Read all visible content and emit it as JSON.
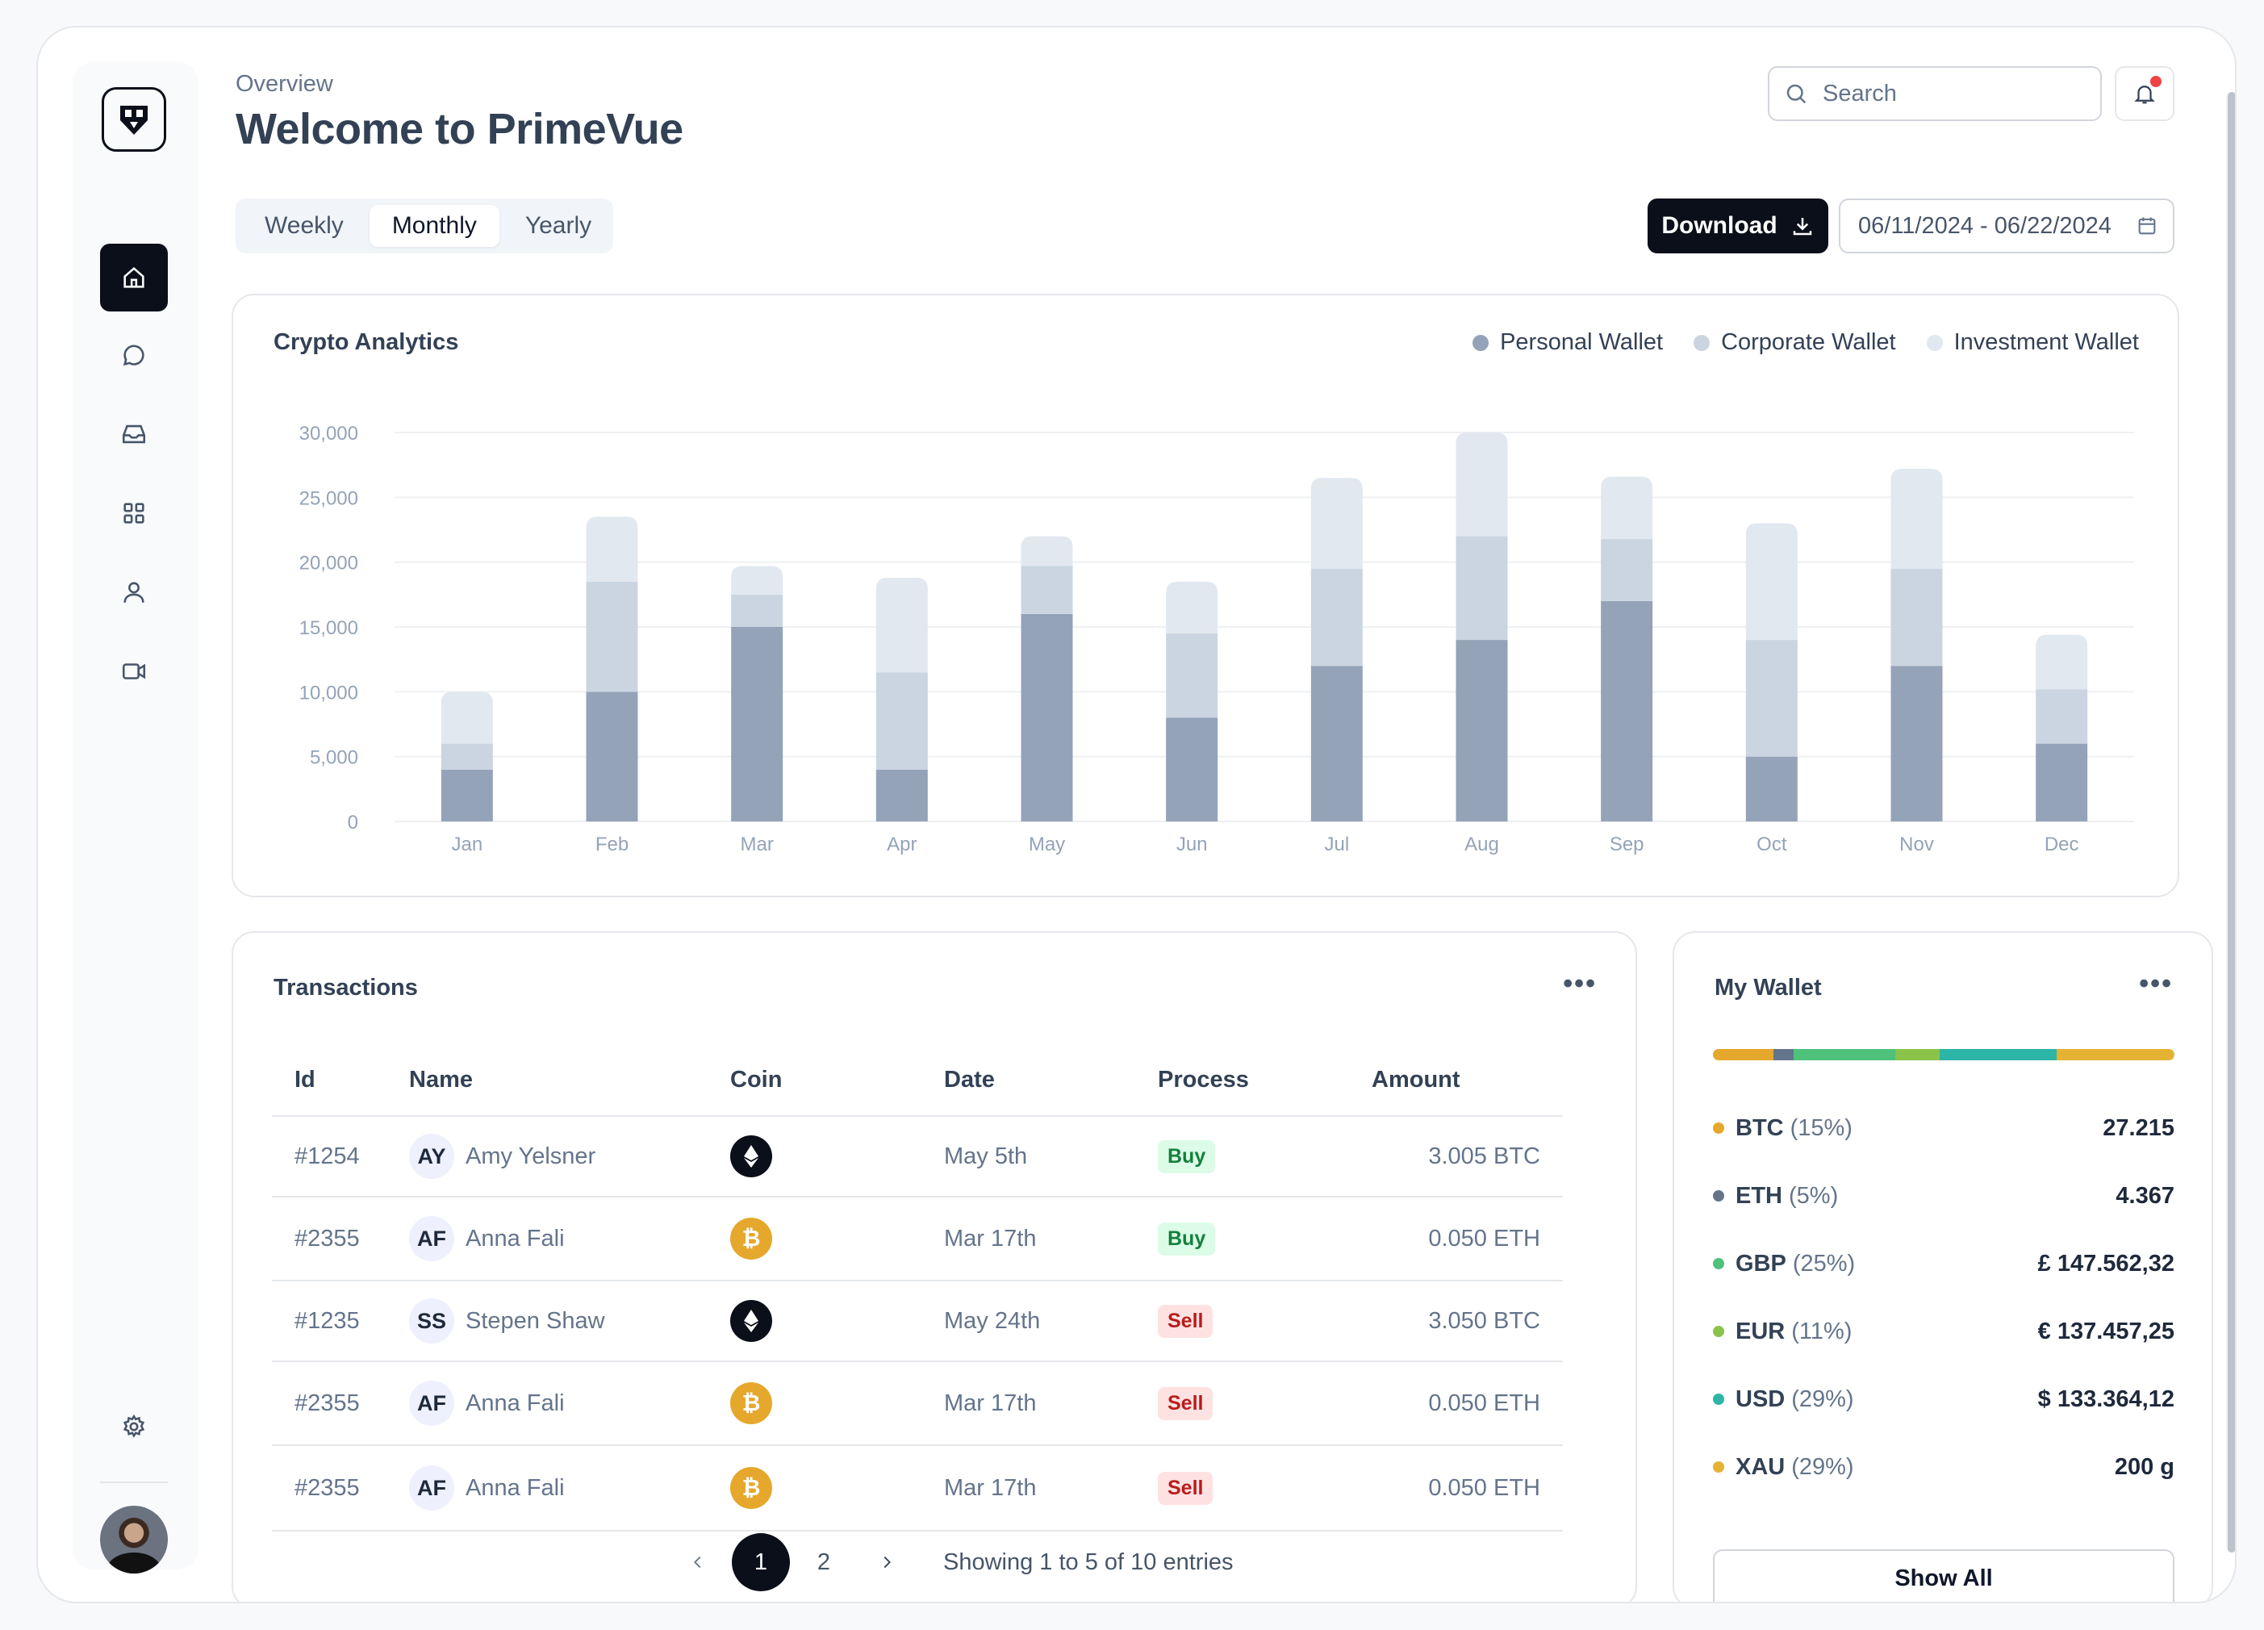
{
  "header": {
    "breadcrumb": "Overview",
    "title": "Welcome to PrimeVue",
    "search_placeholder": "Search"
  },
  "tabs": [
    {
      "label": "Weekly",
      "active": false
    },
    {
      "label": "Monthly",
      "active": true
    },
    {
      "label": "Yearly",
      "active": false
    }
  ],
  "toolbar": {
    "download_label": "Download",
    "date_range": "06/11/2024 - 06/22/2024"
  },
  "sidebar": {
    "items": [
      "home-icon",
      "chat-icon",
      "inbox-icon",
      "apps-icon",
      "user-icon",
      "video-icon"
    ],
    "active": "home-icon",
    "bottom": "gear-icon"
  },
  "chart_data": {
    "type": "bar",
    "title": "Crypto Analytics",
    "stacked": true,
    "categories": [
      "Jan",
      "Feb",
      "Mar",
      "Apr",
      "May",
      "Jun",
      "Jul",
      "Aug",
      "Sep",
      "Oct",
      "Nov",
      "Dec"
    ],
    "series": [
      {
        "name": "Personal Wallet",
        "color": "#94a3b8",
        "values": [
          4000,
          10000,
          15000,
          4000,
          16000,
          8000,
          12000,
          14000,
          17000,
          5000,
          12000,
          6000
        ]
      },
      {
        "name": "Corporate Wallet",
        "color": "#cbd5e1",
        "values": [
          2000,
          8500,
          2500,
          7500,
          3700,
          6500,
          7500,
          8000,
          4800,
          9000,
          7500,
          4200
        ]
      },
      {
        "name": "Investment Wallet",
        "color": "#e2e8f0",
        "values": [
          4000,
          5000,
          2200,
          7300,
          2300,
          4000,
          7000,
          8000,
          4800,
          9000,
          7700,
          4200
        ]
      }
    ],
    "ylim": [
      0,
      30000
    ],
    "yticks": [
      "30,000",
      "25,000",
      "20,000",
      "15,000",
      "10,000",
      "5,000",
      "0"
    ],
    "grid": true,
    "legend": "top-right"
  },
  "transactions": {
    "title": "Transactions",
    "columns": [
      "Id",
      "Name",
      "Coin",
      "Date",
      "Process",
      "Amount"
    ],
    "rows": [
      {
        "id": "#1254",
        "initials": "AY",
        "name": "Amy Yelsner",
        "coin": "eth",
        "date": "May 5th",
        "process": "Buy",
        "amount": "3.005 BTC"
      },
      {
        "id": "#2355",
        "initials": "AF",
        "name": "Anna Fali",
        "coin": "btc",
        "date": "Mar 17th",
        "process": "Buy",
        "amount": "0.050 ETH"
      },
      {
        "id": "#1235",
        "initials": "SS",
        "name": "Stepen Shaw",
        "coin": "eth",
        "date": "May 24th",
        "process": "Sell",
        "amount": "3.050 BTC"
      },
      {
        "id": "#2355",
        "initials": "AF",
        "name": "Anna Fali",
        "coin": "btc",
        "date": "Mar 17th",
        "process": "Sell",
        "amount": "0.050 ETH"
      },
      {
        "id": "#2355",
        "initials": "AF",
        "name": "Anna Fali",
        "coin": "btc",
        "date": "Mar 17th",
        "process": "Sell",
        "amount": "0.050 ETH"
      }
    ],
    "pager": {
      "pages": [
        "1",
        "2"
      ],
      "current": "1",
      "info": "Showing 1 to 5 of 10 entries"
    }
  },
  "wallet": {
    "title": "My Wallet",
    "items": [
      {
        "code": "BTC",
        "pct": "(15%)",
        "value": "27.215",
        "color": "#e5a82c",
        "share": 15
      },
      {
        "code": "ETH",
        "pct": "(5%)",
        "value": "4.367",
        "color": "#64748b",
        "share": 5
      },
      {
        "code": "GBP",
        "pct": "(25%)",
        "value": "£ 147.562,32",
        "color": "#4ec17b",
        "share": 25
      },
      {
        "code": "EUR",
        "pct": "(11%)",
        "value": "€ 137.457,25",
        "color": "#8bc34a",
        "share": 11
      },
      {
        "code": "USD",
        "pct": "(29%)",
        "value": "$ 133.364,12",
        "color": "#2db5a7",
        "share": 29
      },
      {
        "code": "XAU",
        "pct": "(29%)",
        "value": "200 g",
        "color": "#e5b233",
        "share": 29
      }
    ],
    "show_all_label": "Show All"
  }
}
